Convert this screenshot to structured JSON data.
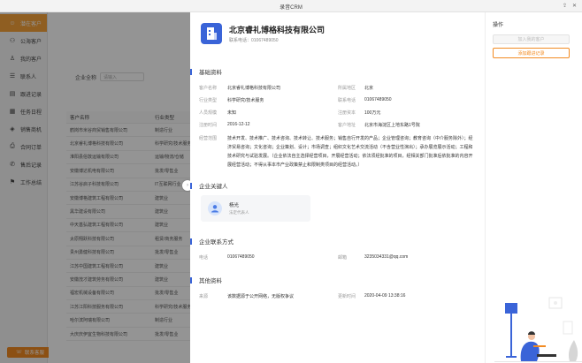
{
  "app": {
    "title": "录音CRM"
  },
  "sidebar": {
    "items": [
      {
        "label": "潜在客户",
        "icon": "person-icon",
        "active": true
      },
      {
        "label": "公海客户",
        "icon": "people-icon"
      },
      {
        "label": "我的客户",
        "icon": "user-icon"
      },
      {
        "label": "联系人",
        "icon": "contacts-icon"
      },
      {
        "label": "跟进记录",
        "icon": "record-icon"
      },
      {
        "label": "任务日程",
        "icon": "calendar-icon"
      },
      {
        "label": "销售商机",
        "icon": "opportunity-icon"
      },
      {
        "label": "合同订单",
        "icon": "contract-icon"
      },
      {
        "label": "售后记录",
        "icon": "service-icon"
      },
      {
        "label": "工作总结",
        "icon": "summary-icon"
      }
    ],
    "contact_service": "联系客服"
  },
  "list": {
    "filter_label": "企业全称",
    "filter_placeholder": "请输入",
    "columns": [
      "客户名称",
      "行业类型"
    ],
    "rows": [
      [
        "鹤岗市米谷商贸销售有限公司",
        "制造行业"
      ],
      [
        "北京睿礼博格科技有限公司",
        "科学研究/技术服务"
      ],
      [
        "淮阳县俗敦运输有限公司",
        "运输/物流/仓储"
      ],
      [
        "安徽博达机电有限公司",
        "批发/零售业"
      ],
      [
        "江苏谷启子科技有限公司",
        "IT互联网行业"
      ],
      [
        "安徽博格建筑工程有限公司",
        "建筑业"
      ],
      [
        "黑华建设有限公司",
        "建筑业"
      ],
      [
        "中天基弘建筑工程有限公司",
        "建筑业"
      ],
      [
        "太原翔跃科技有限公司",
        "租赁/商务服务"
      ],
      [
        "贵州勇健科技有限公司",
        "批发/零售业"
      ],
      [
        "江苏中国建筑工程有限公司",
        "建筑业"
      ],
      [
        "安徽茂才建筑劳务有限公司",
        "建筑业"
      ],
      [
        "福宏机械设备有限公司",
        "批发/零售业"
      ],
      [
        "江苏江阳科技服务有限公司",
        "科学研究/技术服务"
      ],
      [
        "哈尔滨阿瑞有限公司",
        "制造行业"
      ],
      [
        "大庆庆伊宜生物科技有限公司",
        "批发/零售业"
      ]
    ]
  },
  "detail": {
    "company_name": "北京睿礼博格科技有限公司",
    "contact_no": "联系电话：01067489050",
    "sections": {
      "basic": "基础资料",
      "key_people": "企业关键人",
      "contact": "企业联系方式",
      "other": "其他资料"
    },
    "basic_fields": {
      "name_label": "客户名称",
      "name_value": "北京睿礼博格科技有限公司",
      "region_label": "所属地区",
      "region_value": "北京",
      "industry_label": "行业类型",
      "industry_value": "科学研究/技术服务",
      "phone_label": "联系电话",
      "phone_value": "01067489050",
      "scale_label": "人员规模",
      "scale_value": "未知",
      "capital_label": "注册资本",
      "capital_value": "100万元",
      "date_label": "注册时间",
      "date_value": "2016-12-12",
      "address_label": "客户地址",
      "address_value": "北京市海淀区上地东路1号院",
      "scope_label": "经营范围",
      "scope_value": "技术开发、技术推广、技术咨询、技术转让、技术服务；销售自行开发的产品；企业管理咨询；教育咨询（中介服务除外）；经济贸易咨询；文化咨询；企业策划、设计；市场调查；组织文化艺术交流活动（不含营业性演出）；承办展览展示活动；工程和技术研究与试验发展。（企业依法自主选择经营项目，开展经营活动；依法须经批准的项目，经相关部门批准后依批准的内容开展经营活动；不得从事本市产业政策禁止和限制类项目的经营活动。）"
    },
    "key_person": {
      "name": "杨光",
      "role": "法定代表人"
    },
    "contact_fields": {
      "tel_label": "电话",
      "tel_value": "01067489050",
      "email_label": "邮箱",
      "email_value": "3235034331@qq.com"
    },
    "other_fields": {
      "source_label": "来源",
      "source_value": "该数据源于公开网络，无版权争议",
      "updated_label": "更新时间",
      "updated_value": "2020-04-09 13:38:16"
    }
  },
  "actions": {
    "title": "操作",
    "join_button": "加入我的客户",
    "follow_button": "添加跟进记录"
  },
  "colors": {
    "accent": "#f28b22",
    "active_nav": "#f6a23a",
    "brand_blue": "#3a64d8"
  }
}
